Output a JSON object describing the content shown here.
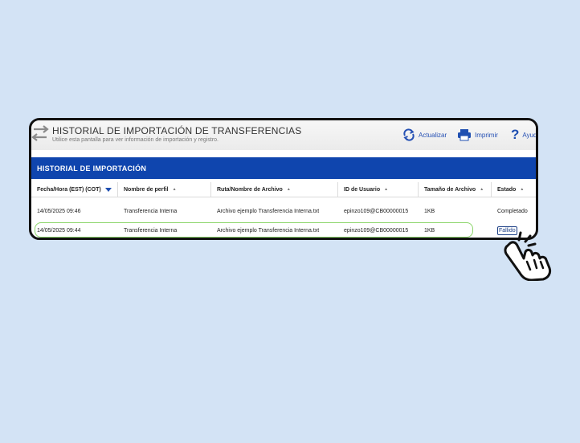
{
  "header": {
    "title": "HISTORIAL DE IMPORTACIÓN DE TRANSFERENCIAS",
    "subtitle": "Utilice esta pantalla para ver información de importación y registro."
  },
  "toolbar": {
    "refresh_label": "Actualizar",
    "print_label": "Imprimir",
    "help_label": "Ayuda"
  },
  "section": {
    "title": "HISTORIAL DE IMPORTACIÓN"
  },
  "table": {
    "columns": [
      "Fecha/Hora (EST) (COT)",
      "Nombre de perfil",
      "Ruta/Nombre de Archivo",
      "ID de Usuario",
      "Tamaño de Archivo",
      "Estado"
    ],
    "rows": [
      [
        "14/05/2025 09:46",
        "Transferencia Interna",
        "Archivo ejemplo Transferencia Interna.txt",
        "epinzo109@CB00000015",
        "1KB",
        "Completado"
      ],
      [
        "14/05/2025 09:44",
        "Transferencia Interna",
        "Archivo ejemplo Transferencia Interna.txt",
        "epinzo109@CB00000015",
        "1KB",
        "Fallido"
      ]
    ]
  },
  "colors": {
    "accent": "#0f45ae",
    "link": "#2651b4",
    "highlight": "#8bd56a",
    "background": "#d3e3f5"
  },
  "icons": {
    "swap": "swap-arrows-icon",
    "refresh": "refresh-icon",
    "print": "printer-icon",
    "help": "question-icon",
    "pointer": "hand-pointer-icon"
  }
}
